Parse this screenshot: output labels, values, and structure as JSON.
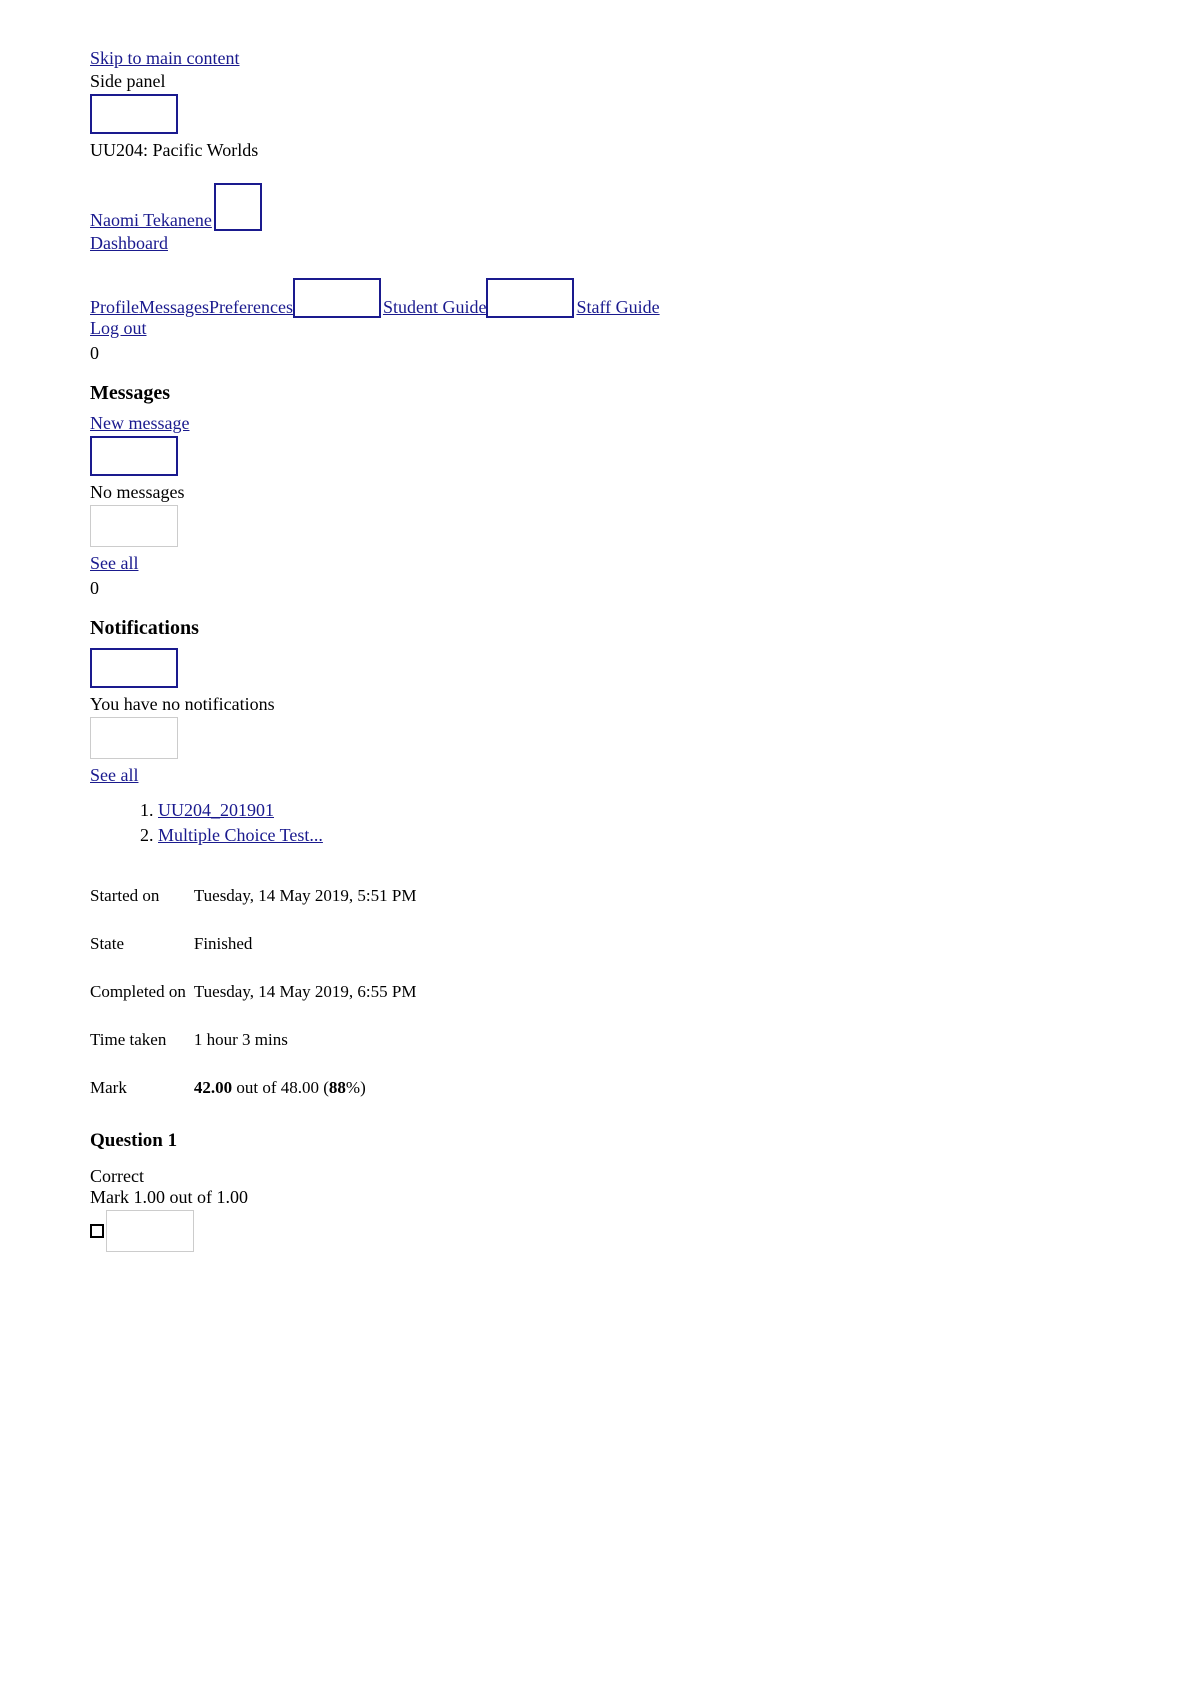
{
  "skip_link": "Skip to main content",
  "side_panel": "Side panel",
  "course_title": "UU204: Pacific Worlds",
  "user_name": "Naomi Tekanene",
  "dashboard_link": "Dashboard",
  "nav": {
    "profile": "Profile",
    "messages": "Messages",
    "preferences": "Preferences",
    "student_guide": "Student Guide",
    "staff_guide": "Staff Guide",
    "logout": "Log out"
  },
  "messages_count": "0",
  "messages_heading": "Messages",
  "new_message": "New message",
  "no_messages": "No messages",
  "see_all_messages": "See all",
  "notifications_count": "0",
  "notifications_heading": "Notifications",
  "no_notifications": "You have no notifications",
  "see_all_notifications": "See all",
  "breadcrumb": {
    "item1": "UU204_201901",
    "item2": "Multiple Choice Test..."
  },
  "summary": {
    "started_on_label": "Started on",
    "started_on_value": "Tuesday, 14 May 2019, 5:51 PM",
    "state_label": "State",
    "state_value": "Finished",
    "completed_on_label": "Completed on",
    "completed_on_value": "Tuesday, 14 May 2019, 6:55 PM",
    "time_taken_label": "Time taken",
    "time_taken_value": "1 hour 3 mins",
    "mark_label": "Mark",
    "mark_scored": "42.00",
    "mark_out_of": " out of 48.00 (",
    "mark_pct": "88",
    "mark_close": "%)"
  },
  "question": {
    "heading": "Question 1",
    "status": "Correct",
    "mark": "Mark 1.00 out of 1.00"
  }
}
